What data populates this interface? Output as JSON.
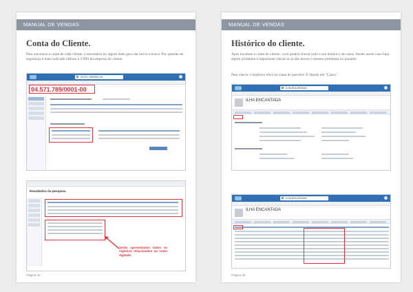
{
  "left": {
    "banner": "MANUAL DE VENDAS",
    "title": "Conta do Cliente.",
    "body": "Para encontrar a conta de cada cliente, é necessário ter algum dado para dar início a busca. Por questão de segurança é mais indicado utilizar o CNPJ da empresa do cliente.",
    "shot1": {
      "search_value": "04.571.789/0001-00",
      "highlight_value": "04.571.789/0001-00"
    },
    "shot2": {
      "page_heading": "Resultados da pesquisa",
      "callout": "Serão apresentados todos os registros relacionados ao nome digitado."
    },
    "page_number": "Página 34"
  },
  "right": {
    "banner": "MANUAL DE VENDAS",
    "title": "Histórico do cliente.",
    "body1": "Após localizar a conta do cliente, você poderá checar todo o seu histórico de casos. Sendo assim caso haja algum problema é importante checar se já não houve o mesmo problema no passado.",
    "body2": "Para checar o histórico clica na conta do parceiro. E depois em \"Casos.\"",
    "shot1": {
      "search_value": "ILHA ENCANTADA",
      "account_name": "ILHA ENCANTADA"
    },
    "shot2": {
      "search_value": "ILHA ENCANTADA",
      "account_name": "ILHA ENCANTADA"
    },
    "page_number": "Página 35"
  },
  "colors": {
    "banner": "#8d97a4",
    "highlight": "#e0303a",
    "app_bar": "#2f6fb5"
  }
}
